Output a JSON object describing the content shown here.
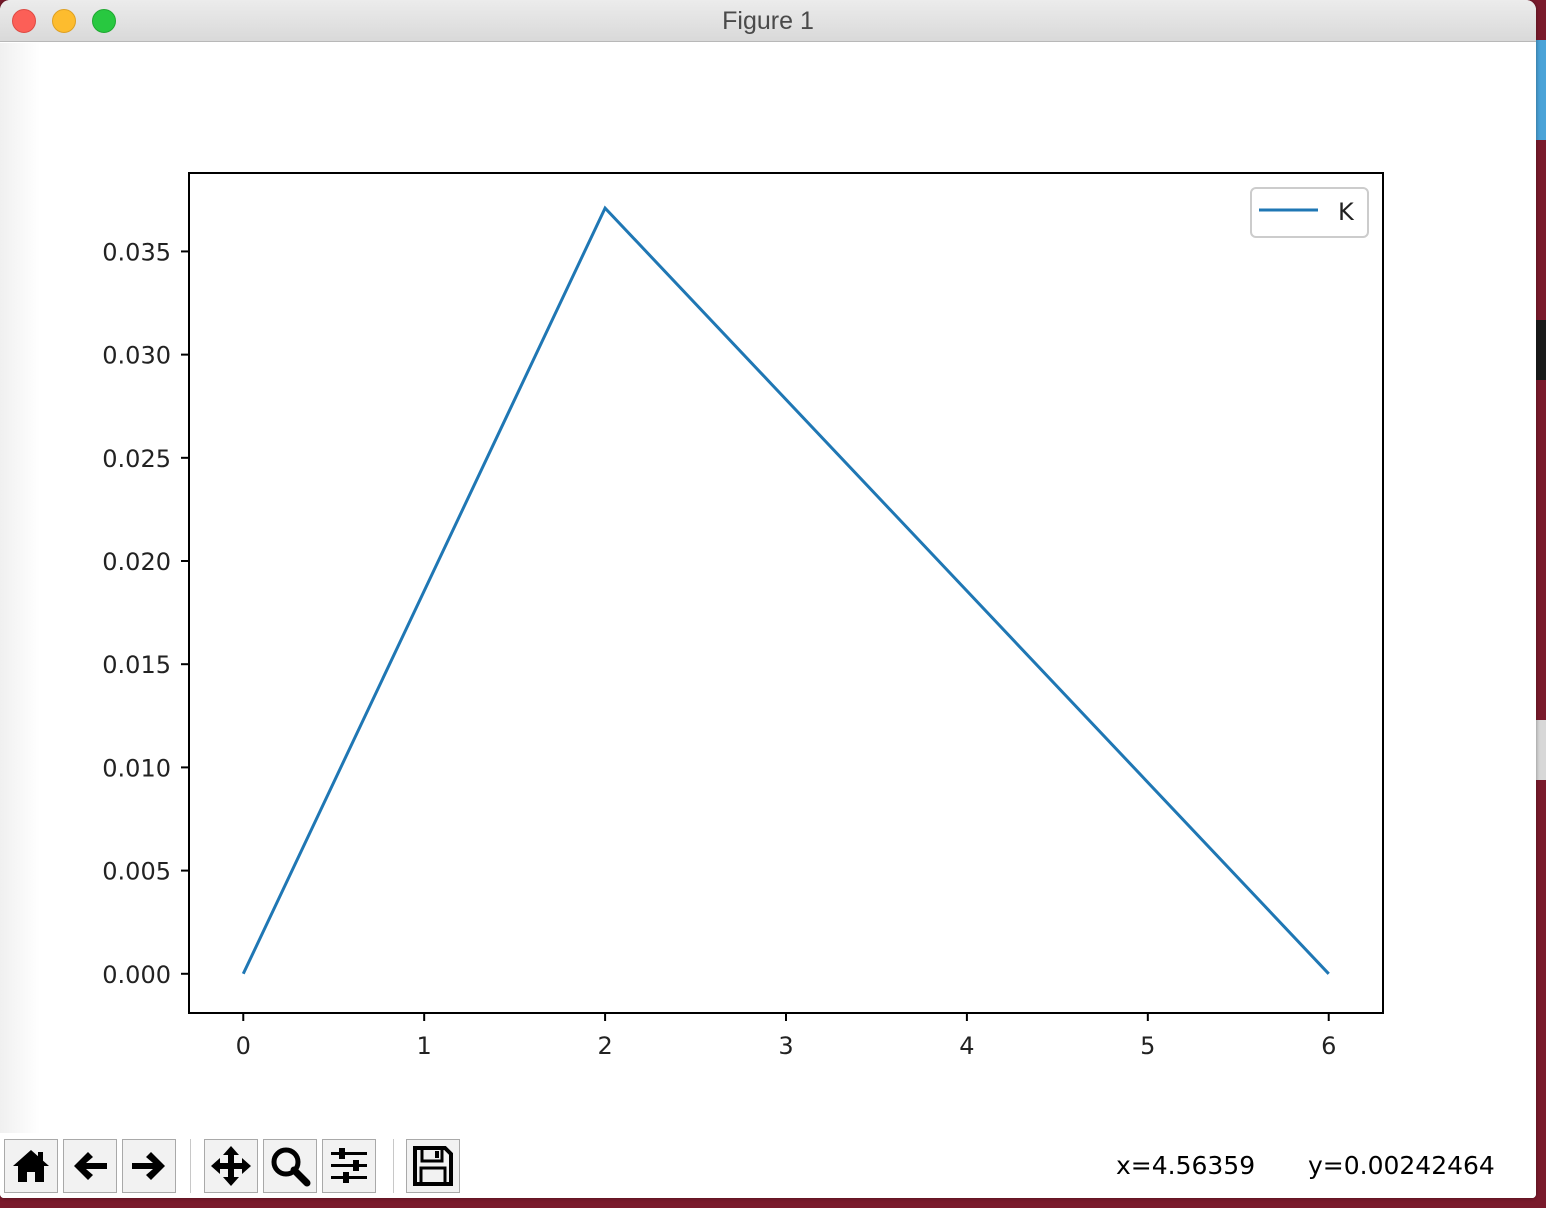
{
  "window": {
    "title": "Figure 1"
  },
  "toolbar": {
    "buttons": [
      {
        "name": "home-button",
        "icon": "home-icon"
      },
      {
        "name": "back-button",
        "icon": "arrow-left-icon"
      },
      {
        "name": "forward-button",
        "icon": "arrow-right-icon"
      },
      {
        "name": "pan-button",
        "icon": "move-icon"
      },
      {
        "name": "zoom-button",
        "icon": "magnifier-icon"
      },
      {
        "name": "configure-subplots-button",
        "icon": "sliders-icon"
      },
      {
        "name": "save-button",
        "icon": "floppy-disk-icon"
      }
    ],
    "x_readout": "x=4.56359",
    "y_readout": "y=0.00242464"
  },
  "chart_data": {
    "type": "line",
    "title": "",
    "xlabel": "",
    "ylabel": "",
    "xlim": [
      -0.3,
      6.3
    ],
    "ylim": [
      -0.0019,
      0.0388
    ],
    "xticks": [
      0,
      1,
      2,
      3,
      4,
      5,
      6
    ],
    "xtick_labels": [
      "0",
      "1",
      "2",
      "3",
      "4",
      "5",
      "6"
    ],
    "yticks": [
      0.0,
      0.005,
      0.01,
      0.015,
      0.02,
      0.025,
      0.03,
      0.035
    ],
    "ytick_labels": [
      "0.000",
      "0.005",
      "0.010",
      "0.015",
      "0.020",
      "0.025",
      "0.030",
      "0.035"
    ],
    "grid": false,
    "legend_position": "top-right",
    "series": [
      {
        "name": "K",
        "color": "#1f77b4",
        "x": [
          0,
          2,
          6
        ],
        "y": [
          0.0,
          0.0371,
          0.0
        ]
      }
    ]
  }
}
